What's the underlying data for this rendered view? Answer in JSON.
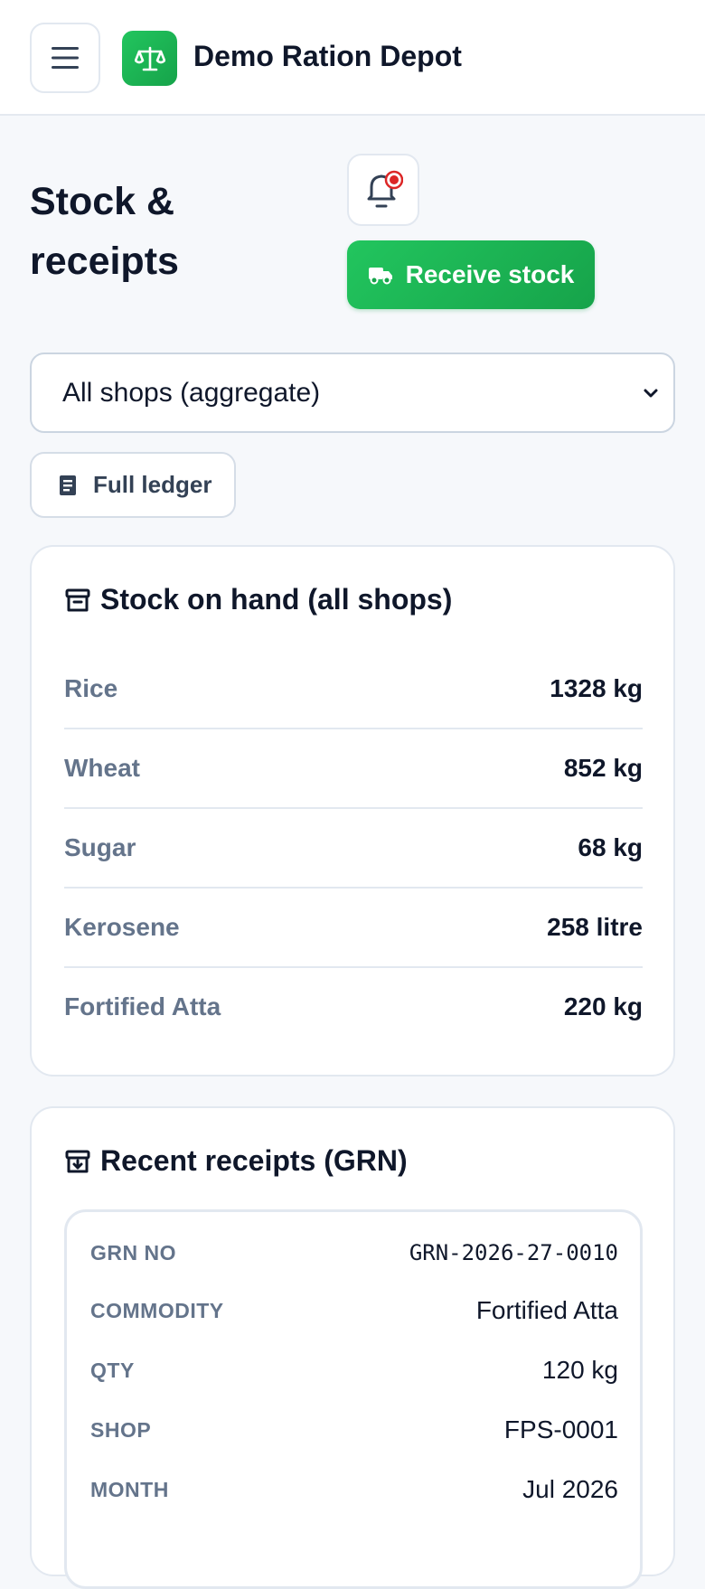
{
  "app": {
    "brand": "Demo Ration Depot"
  },
  "page": {
    "title": "Stock & receipts"
  },
  "actions": {
    "receive_label": "Receive stock",
    "ledger_label": "Full ledger"
  },
  "filter": {
    "selected": "All shops (aggregate)"
  },
  "stock_card": {
    "title": "Stock on hand (all shops)",
    "items": [
      {
        "name": "Rice",
        "qty": "1328 kg"
      },
      {
        "name": "Wheat",
        "qty": "852 kg"
      },
      {
        "name": "Sugar",
        "qty": "68 kg"
      },
      {
        "name": "Kerosene",
        "qty": "258 litre"
      },
      {
        "name": "Fortified Atta",
        "qty": "220 kg"
      }
    ]
  },
  "receipts_card": {
    "title": "Recent receipts (GRN)",
    "receipt": {
      "grn_no": {
        "label": "GRN NO",
        "value": "GRN-2026-27-0010"
      },
      "commodity": {
        "label": "COMMODITY",
        "value": "Fortified Atta"
      },
      "qty": {
        "label": "QTY",
        "value": "120 kg"
      },
      "shop": {
        "label": "SHOP",
        "value": "FPS-0001"
      },
      "month": {
        "label": "MONTH",
        "value": "Jul 2026"
      }
    }
  },
  "colors": {
    "accent": "#22c55e",
    "accent_dark": "#16a34a",
    "notification_dot": "#dc2626",
    "muted": "#64748b"
  },
  "icons": [
    "hamburger-menu-icon",
    "scale-icon",
    "bell-icon",
    "truck-icon",
    "ledger-icon",
    "archive-icon",
    "archive-in-icon",
    "chevron-down-icon"
  ]
}
